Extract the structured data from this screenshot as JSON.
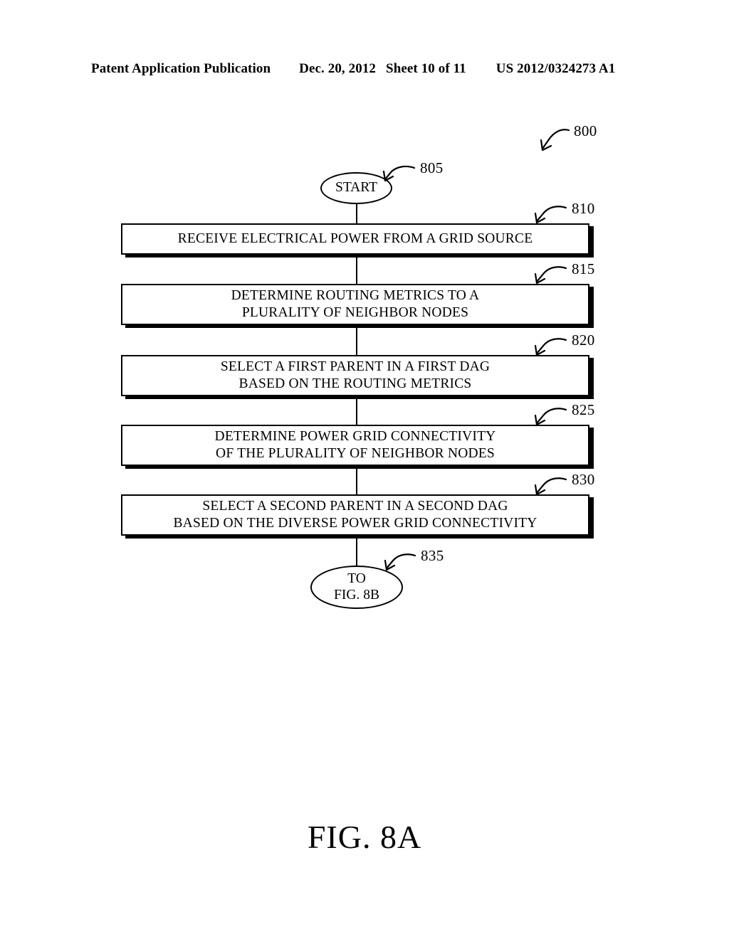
{
  "header": {
    "publication": "Patent Application Publication",
    "date": "Dec. 20, 2012",
    "sheet": "Sheet 10 of 11",
    "patent_number": "US 2012/0324273 A1"
  },
  "figure": {
    "caption": "FIG. 8A",
    "diagram_ref": "800",
    "line_color": "#000000",
    "background": "#ffffff"
  },
  "flowchart": {
    "start": {
      "ref": "805",
      "label": "START"
    },
    "steps": [
      {
        "ref": "810",
        "line1": "RECEIVE ELECTRICAL POWER FROM A GRID SOURCE",
        "line2": ""
      },
      {
        "ref": "815",
        "line1": "DETERMINE ROUTING METRICS TO A",
        "line2": "PLURALITY OF NEIGHBOR NODES"
      },
      {
        "ref": "820",
        "line1": "SELECT A FIRST PARENT IN A FIRST DAG",
        "line2": "BASED ON THE ROUTING METRICS"
      },
      {
        "ref": "825",
        "line1": "DETERMINE POWER GRID CONNECTIVITY",
        "line2": "OF THE PLURALITY OF NEIGHBOR NODES"
      },
      {
        "ref": "830",
        "line1": "SELECT A SECOND PARENT IN A SECOND DAG",
        "line2": "BASED ON THE DIVERSE POWER GRID CONNECTIVITY"
      }
    ],
    "end": {
      "ref": "835",
      "line1": "TO",
      "line2": "FIG. 8B"
    }
  }
}
